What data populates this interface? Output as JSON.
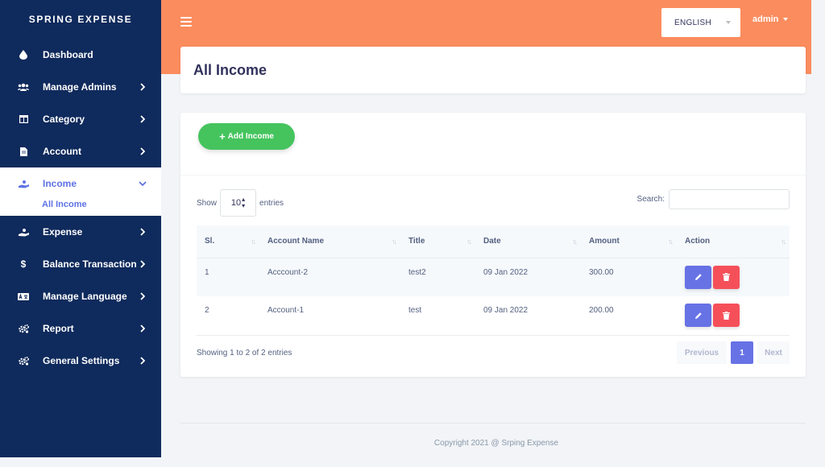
{
  "sidebar": {
    "brand": "SPRING EXPENSE",
    "items": [
      {
        "label": "Dashboard",
        "icon": "drop-icon"
      },
      {
        "label": "Manage Admins",
        "icon": "users-icon"
      },
      {
        "label": "Category",
        "icon": "columns-icon"
      },
      {
        "label": "Account",
        "icon": "file-icon"
      },
      {
        "label": "Income",
        "icon": "hand-holding-icon"
      },
      {
        "label": "Expense",
        "icon": "hand-icon"
      },
      {
        "label": "Balance Transaction",
        "icon": "dollar-icon"
      },
      {
        "label": "Manage Language",
        "icon": "language-icon"
      },
      {
        "label": "Report",
        "icon": "cogs-icon"
      },
      {
        "label": "General Settings",
        "icon": "cogs-icon"
      }
    ],
    "income_submenu": "All Income"
  },
  "header": {
    "language": "ENGLISH",
    "user": "admin"
  },
  "page": {
    "title": "All Income",
    "add_button": "Add Income"
  },
  "table_controls": {
    "show_label": "Show",
    "entries_value": "10",
    "entries_label": "entries",
    "search_label": "Search:",
    "search_value": ""
  },
  "table": {
    "columns": [
      "Sl.",
      "Account Name",
      "Title",
      "Date",
      "Amount",
      "Action"
    ],
    "rows": [
      {
        "sl": "1",
        "account": "Acccount-2",
        "title": "test2",
        "date": "09 Jan 2022",
        "amount": "300.00"
      },
      {
        "sl": "2",
        "account": "Account-1",
        "title": "test",
        "date": "09 Jan 2022",
        "amount": "200.00"
      }
    ]
  },
  "pagination": {
    "info": "Showing 1 to 2 of 2 entries",
    "previous": "Previous",
    "current": "1",
    "next": "Next"
  },
  "footer": {
    "copyright": "Copyright 2021 @ Srping Expense"
  },
  "colors": {
    "sidebar": "#0f2a5c",
    "topbar": "#fb8c5e",
    "accent": "#5e72e4",
    "add_button": "#45c45e",
    "edit": "#6772e5",
    "delete": "#f5505a"
  }
}
